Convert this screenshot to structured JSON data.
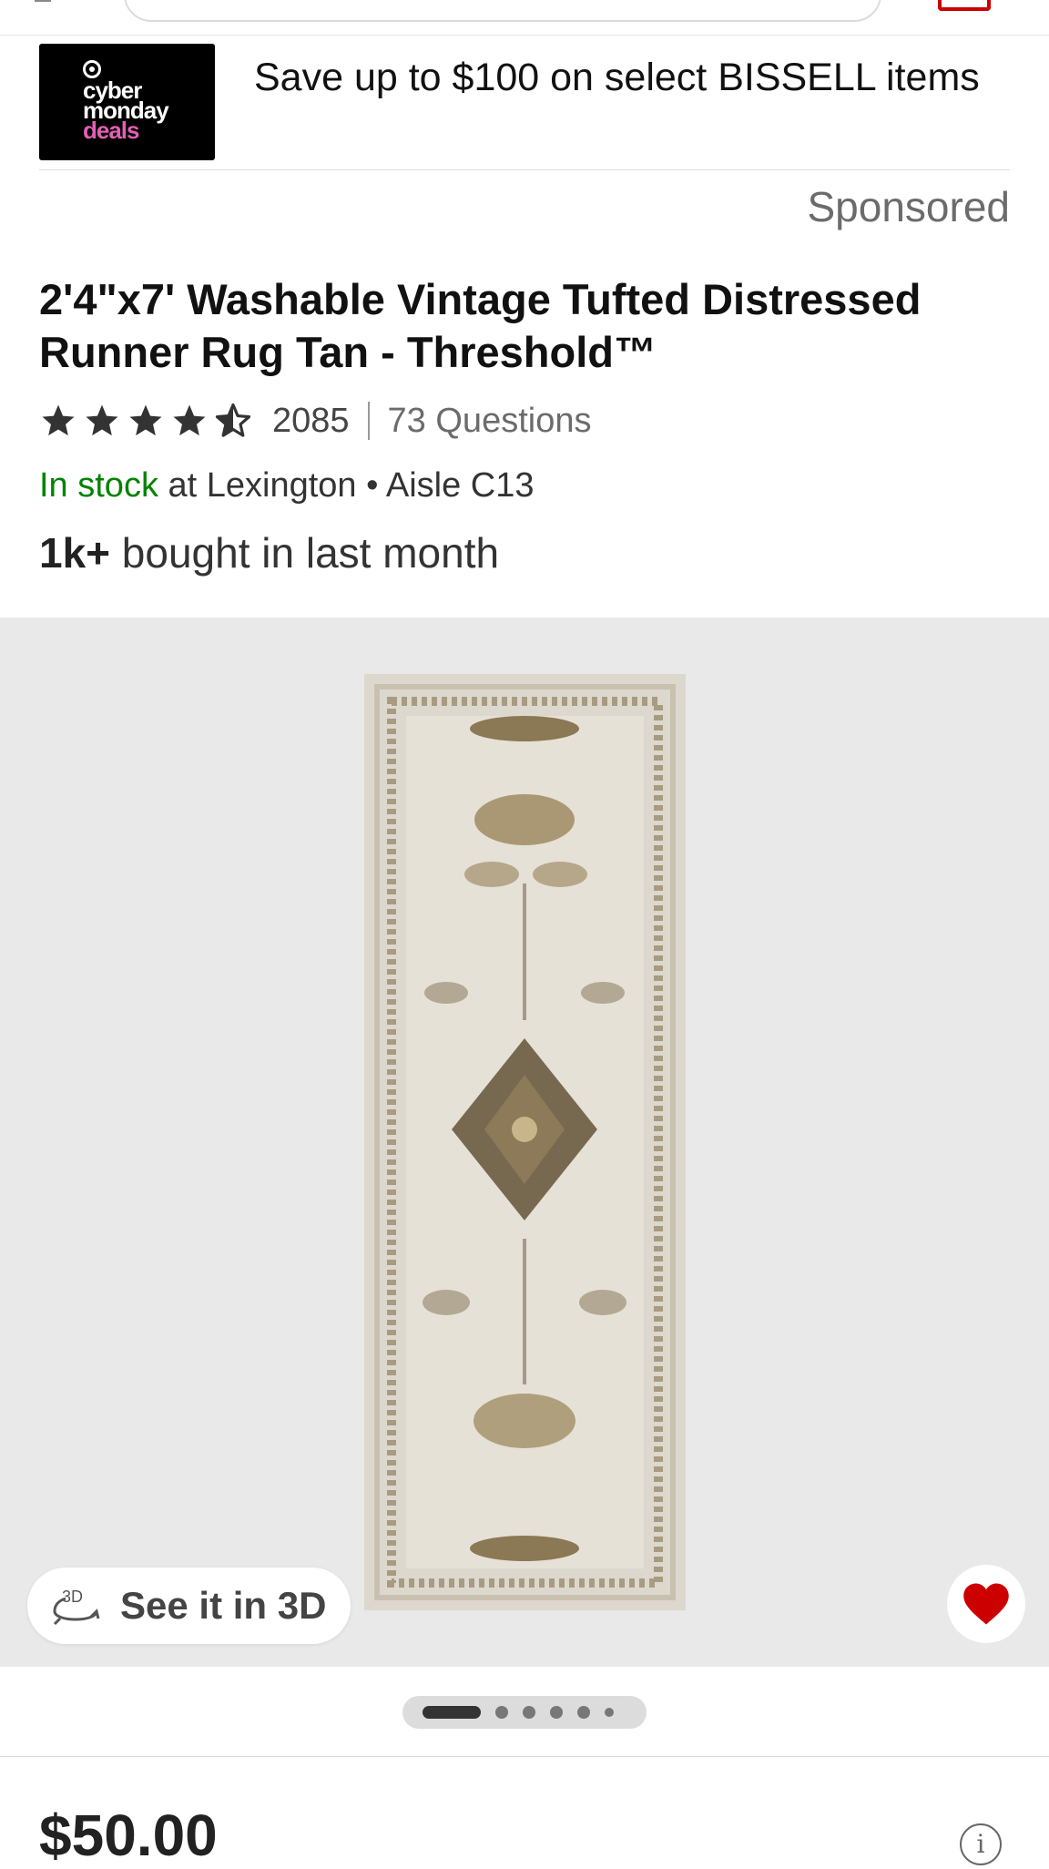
{
  "promo": {
    "badge_line1": "cyber",
    "badge_line2": "monday",
    "badge_line3": "deals",
    "text": "Save up to $100 on select BISSELL items",
    "sponsored": "Sponsored"
  },
  "product": {
    "title": "2'4\"x7' Washable Vintage Tufted Distressed Runner Rug Tan - Threshold™",
    "rating_value": 4.5,
    "rating_count": "2085",
    "questions": "73 Questions",
    "stock_status": "In stock",
    "stock_location": " at Lexington • Aisle C13",
    "bought_strong": "1k+",
    "bought_rest": " bought in last month",
    "see_3d": "See it in 3D",
    "price": "$50.00"
  },
  "carousel": {
    "total": 6,
    "active_index": 0
  },
  "colors": {
    "accent": "#cc0000",
    "in_stock": "#008300",
    "badge_pink": "#e35fb6"
  },
  "icons": [
    "back-arrow-icon",
    "cart-icon",
    "star-icon",
    "3d-rotate-icon",
    "heart-icon",
    "info-icon"
  ]
}
